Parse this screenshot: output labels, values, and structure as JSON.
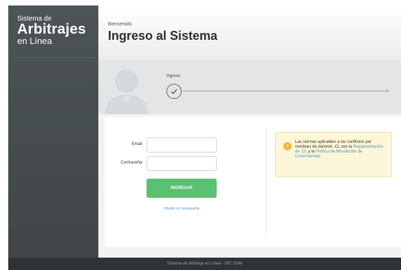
{
  "sidebar": {
    "brand_line1": "Sistema de",
    "brand_line2": "Arbitrajes",
    "brand_line3": "en Línea"
  },
  "header": {
    "welcome": "Bienvenido",
    "title": "Ingreso al Sistema"
  },
  "steps": {
    "current_label": "Ingreso"
  },
  "login": {
    "email_label": "Email:",
    "email_value": "",
    "password_label": "Contraseña:",
    "password_value": "",
    "submit_label": "INGRESAR",
    "forgot_label": "Olvidé mi contraseña"
  },
  "notice": {
    "text_before": "Las normas aplicables a los conflictos por nombres de dominio .CL son la ",
    "link1": "Reglamentación de .CL",
    "text_middle": " y la ",
    "link2": "Política de Resolución de Controversias"
  },
  "footer": {
    "text": "Sistema de Arbitraje en Línea - NIC Chile"
  },
  "colors": {
    "sidebar": "#464d50",
    "accent_green": "#5cc072",
    "link_blue": "#4a90c8",
    "warning": "#f2b63c"
  },
  "icons": [
    "user-avatar-icon",
    "check-circle-icon",
    "arrow-right-icon",
    "warning-icon"
  ]
}
